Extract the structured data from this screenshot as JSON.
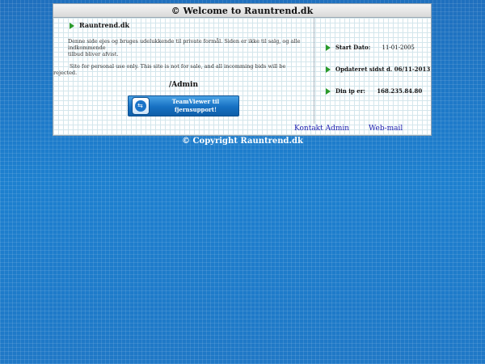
{
  "header": {
    "title": "© Welcome to Rauntrend.dk"
  },
  "main": {
    "heading": "Rauntrend.dk",
    "danish_line1": "Denne side ejes og bruges udelukkende til private formål. Siden er ikke til salg, og alle indkommende",
    "danish_line2": "tilbud bliver afvist.",
    "english_line1": "Site for personal use only. This site is not for sale, and all incomming bids will be",
    "english_line2": "rejected.",
    "admin_label": "/Admin",
    "teamviewer_button": {
      "line1": "TeamViewer til",
      "line2": "fjernsupport!"
    }
  },
  "info": {
    "start_label": "Start Dato:",
    "start_value": "11-01-2005",
    "updated_label": "Opdateret sidst d. 06/11-2013",
    "ip_label": "Din ip er:",
    "ip_value": "168.235.84.80"
  },
  "footer": {
    "links": [
      "Kontakt Admin",
      "Web-mail"
    ],
    "copyright": "© Copyright Rauntrend.dk"
  },
  "colors": {
    "background": "#1f78c6",
    "arrow": "#2a9a2a",
    "link": "#2020b0"
  },
  "icons": [
    "arrow-icon",
    "teamviewer-icon"
  ]
}
